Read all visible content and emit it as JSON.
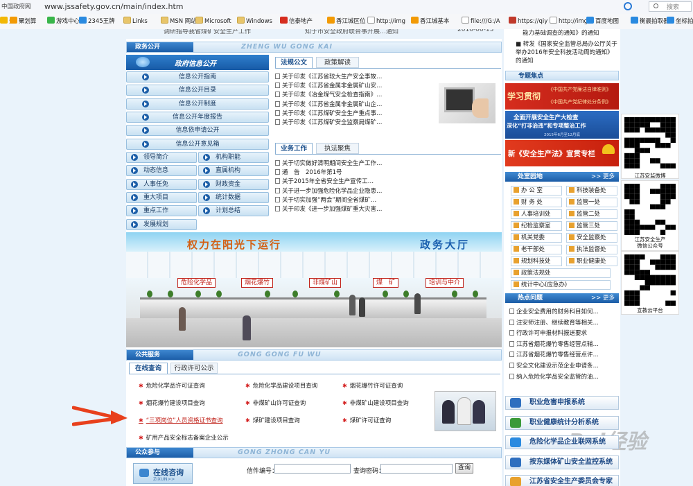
{
  "browser": {
    "site_badge": "中国政府网",
    "url": "www.jssafety.gov.cn/main/index.htm",
    "search_label": "搜索",
    "favorites": [
      "全",
      "聚划算",
      "游戏中心",
      "2345王牌",
      "Links",
      "MSN 网站",
      "Microsoft",
      "Windows",
      "信泰地产",
      "香江城区位",
      "http://img",
      "香江城基本",
      "file:///G:/A",
      "https://qiy",
      "http://img",
      "百度地图",
      "衡晨拍取器",
      "坐标拍"
    ]
  },
  "top_cut": {
    "left_text": "调研指导我省煤矿安全生产工作",
    "mid_text": "知于市安全政府联合事开展…通知",
    "date": "2016-06-13"
  },
  "gov_open": {
    "tab_label": "政务公开",
    "pinyin": "ZHENG WU GONG KAI",
    "info_header": "政府信息公开",
    "info_items": [
      "信息公开指南",
      "信息公开目录",
      "信息公开制度",
      "信息公开年度报告",
      "信息依申请公开",
      "信息公开意见箱"
    ],
    "grid_items": [
      "领导简介",
      "机构职能",
      "动态信息",
      "直属机构",
      "人事任免",
      "财政资金",
      "重大项目",
      "统计数据",
      "重点工作",
      "计划总结",
      "发展规划"
    ]
  },
  "laws": {
    "tabs": [
      "法规公文",
      "政策解读"
    ],
    "items": [
      "关于印发《江苏省较大生产安全事故…",
      "关于印发《江苏省金属非金属矿山安…",
      "关于印发《冶金煤气安全检查指南》…",
      "关于印发《江苏省金属非金属矿山企…",
      "关于印发《江苏煤矿安全生产重点事…",
      "关于印发《江苏煤矿安全监察局煤矿…"
    ]
  },
  "work": {
    "tabs": [
      "业务工作",
      "执法聚焦"
    ],
    "items": [
      "关于切实做好清明期间安全生产工作…",
      "通　告　2016年第1号",
      "关于2015年全省安全生产宣传工…",
      "关于进一步加强危险化学品企业隐患…",
      "关于切实加强“两会”期间全省煤矿…",
      "关于印发《进一步加强煤矿重大灾害…"
    ]
  },
  "hall": {
    "slogan": "权力在阳光下运行",
    "title": "政务大厅",
    "windows": [
      "危险化学品",
      "烟花爆竹",
      "非煤矿山",
      "煤　矿",
      "培训与中介"
    ]
  },
  "public_service": {
    "tab_label": "公共服务",
    "pinyin": "GONG GONG FU WU",
    "tabs": [
      "在线查询",
      "行政许可公示"
    ],
    "items": [
      "危险化学品许可证查询",
      "危险化学品建设项目查询",
      "烟花爆竹许可证查询",
      "烟花爆竹建设项目查询",
      "非煤矿山许可证查询",
      "非煤矿山建设项目查询",
      "“三项岗位”人员资格证书查询",
      "煤矿建设项目查询",
      "煤矿许可证查询",
      "矿用产品安全标志备案企业公示"
    ]
  },
  "public_participation": {
    "tab_label": "公众参与",
    "pinyin": "GONG ZHONG CAN YU",
    "consult_label": "在线咨询",
    "consult_sub": "ZIXUN>>",
    "letter_no_label": "信件编号：",
    "query_code_label": "查询密码：",
    "query_button": "查询"
  },
  "sidebar": {
    "top_notice_1": "能力基础调查的通知》的通知",
    "top_notice_2": "转发《国家安全监管总局办公厅关于举办2016年安全科技活动周的通知》的通知",
    "topics_label": "专题焦点",
    "banner1_a": "学习贯彻",
    "banner1_b": "《中国共产党廉洁自律准则》",
    "banner1_c": "《中国共产党纪律处分条例》",
    "banner2_a": "全面开展安全生产大检查",
    "banner2_b": "深化“打非治违”和专项整治工作",
    "banner2_date": "2015年6月至12月底",
    "banner3": "新《安全生产法》宣贯专栏",
    "dept_label": "处室园地",
    "more": ">> 更多",
    "depts": [
      "办 公 室",
      "科技装备处",
      "财 务 处",
      "监管一处",
      "人事培训处",
      "监管二处",
      "纪检监察室",
      "监管三处",
      "机关党委",
      "安全监察处",
      "老干部处",
      "执法监督处",
      "规划科技处",
      "职业健康处",
      "政策法规处",
      "统计中心(应急办)"
    ],
    "hot_label": "热点问题",
    "hot_items": [
      "企业安全费用的财务科目如何…",
      "注安师注册、继续教育等相关…",
      "行政许可申报材料报送要求",
      "江苏省烟花爆竹零售经营点辅…",
      "江苏省烟花爆竹零售经营点许…",
      "安全文化建设示范企业申请条…",
      "纳入危险化学品安全监管的油…"
    ],
    "big_buttons": [
      "职业危害申报系统",
      "职业健康统计分析系统",
      "危险化学品企业联网系统",
      "按东媒体矿山安全监控系统",
      "江苏省安全生产委员会专家库"
    ]
  },
  "qrcodes": [
    "江苏安监微博",
    "江苏安全生产\n微信公众号",
    "宣教云平台"
  ],
  "watermark": "Bai经验"
}
